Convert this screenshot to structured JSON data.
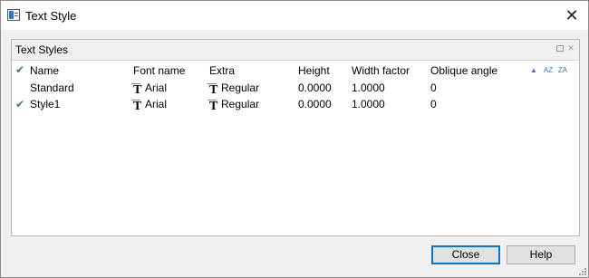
{
  "window": {
    "title": "Text Style",
    "close_glyph": "✕",
    "app_icon": "text-style-app-icon"
  },
  "panel": {
    "title": "Text Styles",
    "pin_icon": "pin-icon",
    "close_glyph": "✕"
  },
  "table": {
    "columns": [
      "Name",
      "Font name",
      "Extra",
      "Height",
      "Width factor",
      "Oblique angle"
    ],
    "header_check": "✔",
    "sort_icons": [
      "sort-asc-icon",
      "sort-az-icon",
      "sort-za-icon"
    ],
    "rows": [
      {
        "current": false,
        "name": "Standard",
        "font": "Arial",
        "extra": "Regular",
        "height": "0.0000",
        "width_factor": "1.0000",
        "oblique": "0"
      },
      {
        "current": true,
        "check": "✔",
        "name": "Style1",
        "font": "Arial",
        "extra": "Regular",
        "height": "0.0000",
        "width_factor": "1.0000",
        "oblique": "0"
      }
    ]
  },
  "buttons": {
    "close": "Close",
    "help": "Help"
  },
  "colors": {
    "check": "#2e8b57",
    "accent": "#0078d7"
  }
}
